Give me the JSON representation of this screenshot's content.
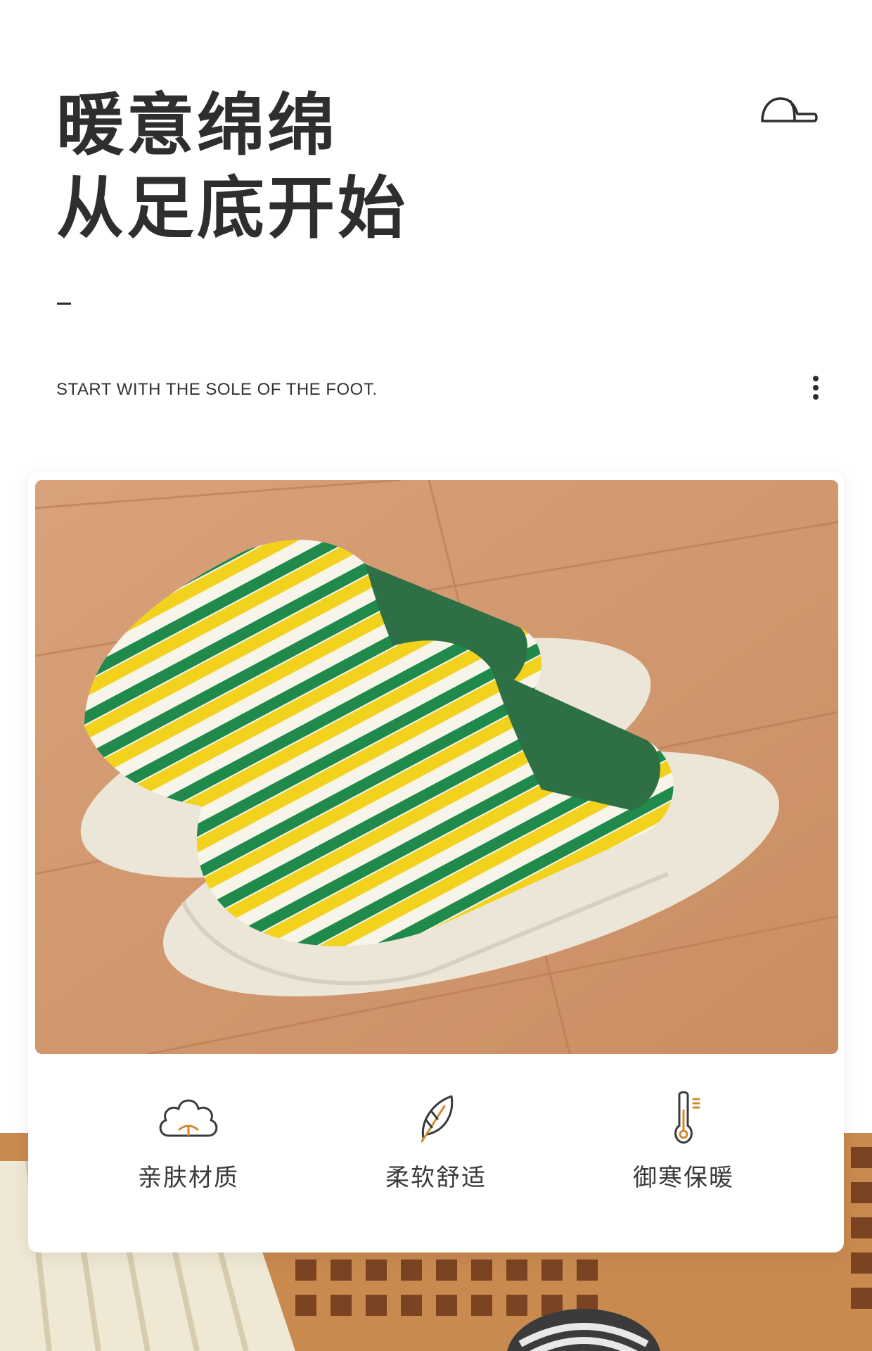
{
  "headline": {
    "line1": "暖意绵绵",
    "line2": "从足底开始"
  },
  "subtitle": "START WITH THE SOLE OF THE FOOT.",
  "icons": {
    "top_right": "cap-icon",
    "menu": "more-vertical-icon"
  },
  "product_image": {
    "subject": "striped-slippers",
    "stripe_colors": [
      "#1f8a4c",
      "#f2d21d",
      "#f7f4ea"
    ],
    "sole_color": "#ece6d8",
    "floor_color": "#d39a72"
  },
  "features": [
    {
      "icon": "cotton-icon",
      "label": "亲肤材质"
    },
    {
      "icon": "leaf-icon",
      "label": "柔软舒适"
    },
    {
      "icon": "thermometer-icon",
      "label": "御寒保暖"
    }
  ]
}
